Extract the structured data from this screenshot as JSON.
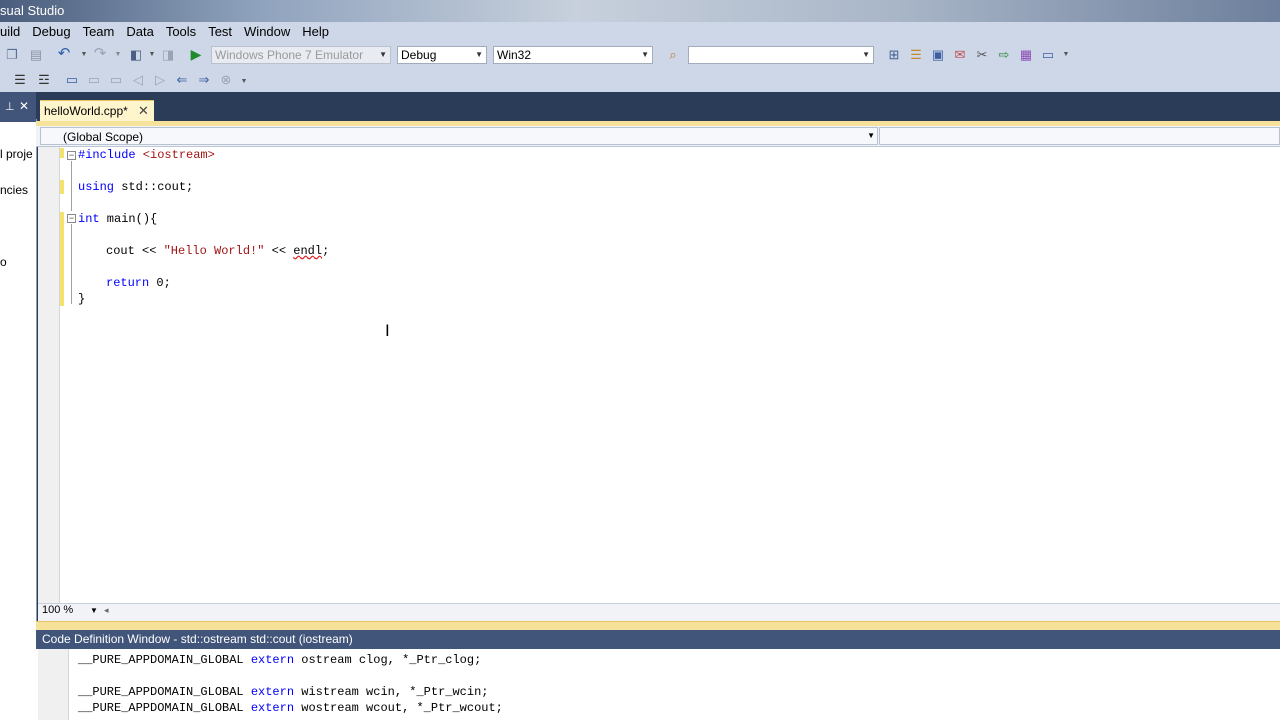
{
  "window": {
    "title": "sual Studio"
  },
  "menu": [
    "uild",
    "Debug",
    "Team",
    "Data",
    "Tools",
    "Test",
    "Window",
    "Help"
  ],
  "toolbar": {
    "platform_combo": "Windows Phone 7 Emulator",
    "config_combo": "Debug",
    "target_combo": "Win32",
    "find_combo": ""
  },
  "left_panel": {
    "items": [
      "l proje",
      "ncies",
      "o"
    ]
  },
  "editor_tab": {
    "label": "helloWorld.cpp*",
    "close": "✕"
  },
  "navigation": {
    "scope": "(Global Scope)"
  },
  "code_lines": {
    "l1_kw": "#include",
    "l1_rest": " <iostream>",
    "l2_kw": "using",
    "l2_rest": " std::cout;",
    "l3_kw": "int",
    "l3_rest": " main(){",
    "l4_a": "cout << ",
    "l4_str": "\"Hello World!\"",
    "l4_b": " << ",
    "l4_err": "endl",
    "l4_c": ";",
    "l5_kw": "return",
    "l5_rest": " 0;",
    "l6": "}"
  },
  "zoom": {
    "level": "100 %"
  },
  "code_definition": {
    "title": "Code Definition Window - std::ostream std::cout (iostream)",
    "line1_a": "__PURE_APPDOMAIN_GLOBAL ",
    "line1_kw": "extern",
    "line1_b": " ostream clog, *_Ptr_clog;",
    "line2_a": "__PURE_APPDOMAIN_GLOBAL ",
    "line2_kw": "extern",
    "line2_b": " wistream wcin, *_Ptr_wcin;",
    "line3_a": "__PURE_APPDOMAIN_GLOBAL ",
    "line3_kw": "extern",
    "line3_b": " wostream wcout, *_Ptr_wcout;"
  },
  "colors": {
    "keyword": "#0000ff",
    "string": "#a31515",
    "accent": "#f6e29b",
    "chrome": "#2b3c59"
  }
}
